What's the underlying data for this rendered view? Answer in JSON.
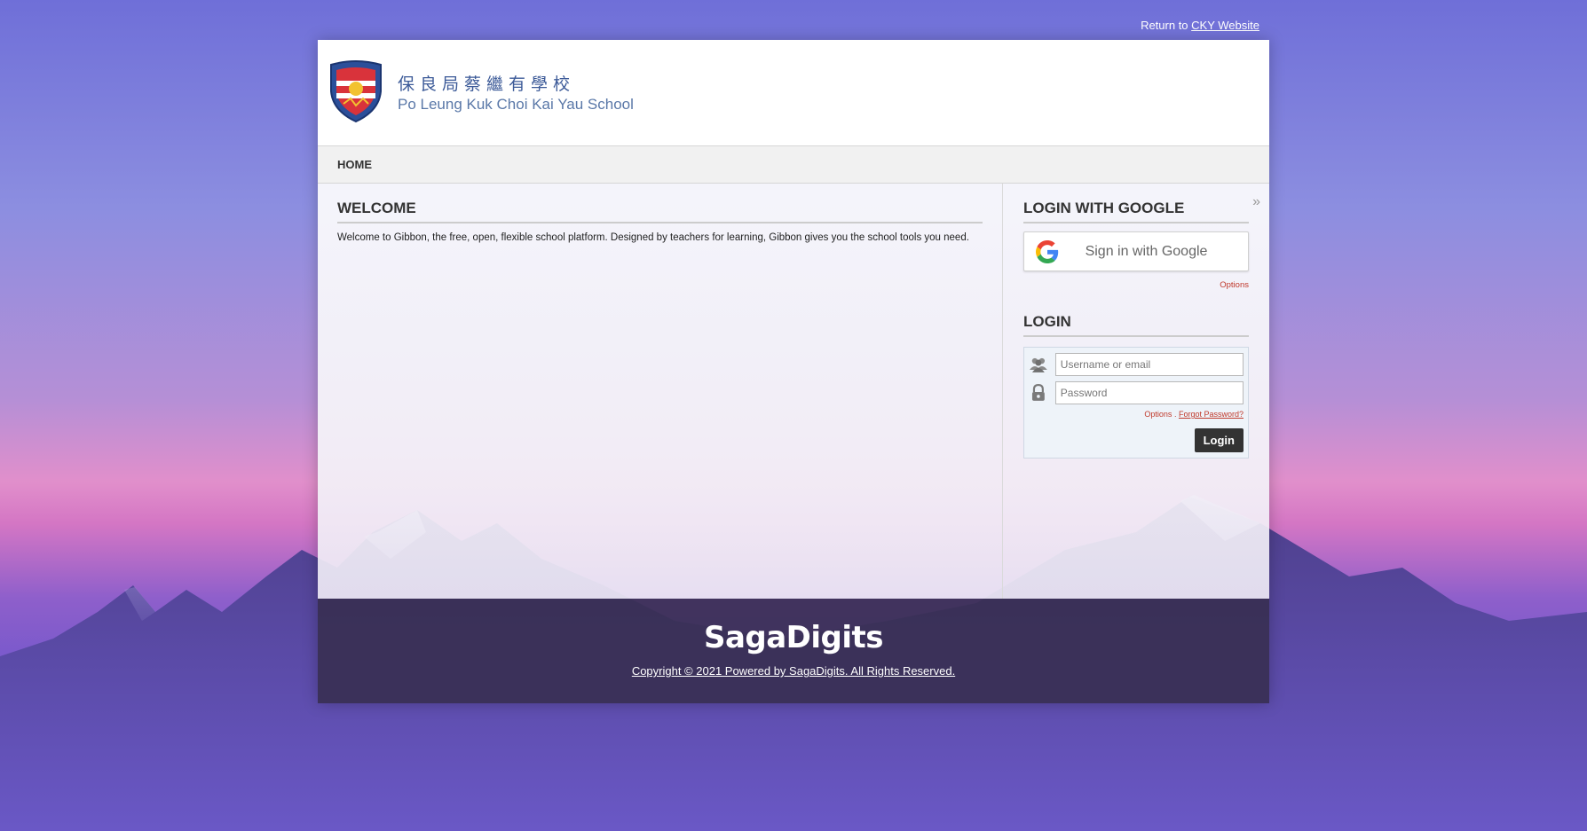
{
  "top_bar": {
    "return_prefix": "Return to ",
    "return_link": "CKY Website"
  },
  "header": {
    "school_name_cn": "保良局蔡繼有學校",
    "school_name_en": "Po Leung Kuk Choi Kai Yau School"
  },
  "nav": {
    "home": "HOME"
  },
  "welcome": {
    "title": "WELCOME",
    "text": "Welcome to Gibbon, the free, open, flexible school platform. Designed by teachers for learning, Gibbon gives you the school tools you need."
  },
  "google_login": {
    "title": "LOGIN WITH GOOGLE",
    "button_label": "Sign in with Google",
    "options": "Options"
  },
  "login": {
    "title": "LOGIN",
    "username_placeholder": "Username or email",
    "password_placeholder": "Password",
    "options": "Options",
    "separator": " . ",
    "forgot": "Forgot Password?",
    "button": "Login"
  },
  "footer": {
    "brand": "SagaDigits",
    "copyright": "Copyright © 2021 Powered by SagaDigits. All Rights Reserved."
  },
  "colors": {
    "accent_link": "#c0392b",
    "school_blue": "#3c5a98",
    "footer_bg": "#372e4e"
  }
}
